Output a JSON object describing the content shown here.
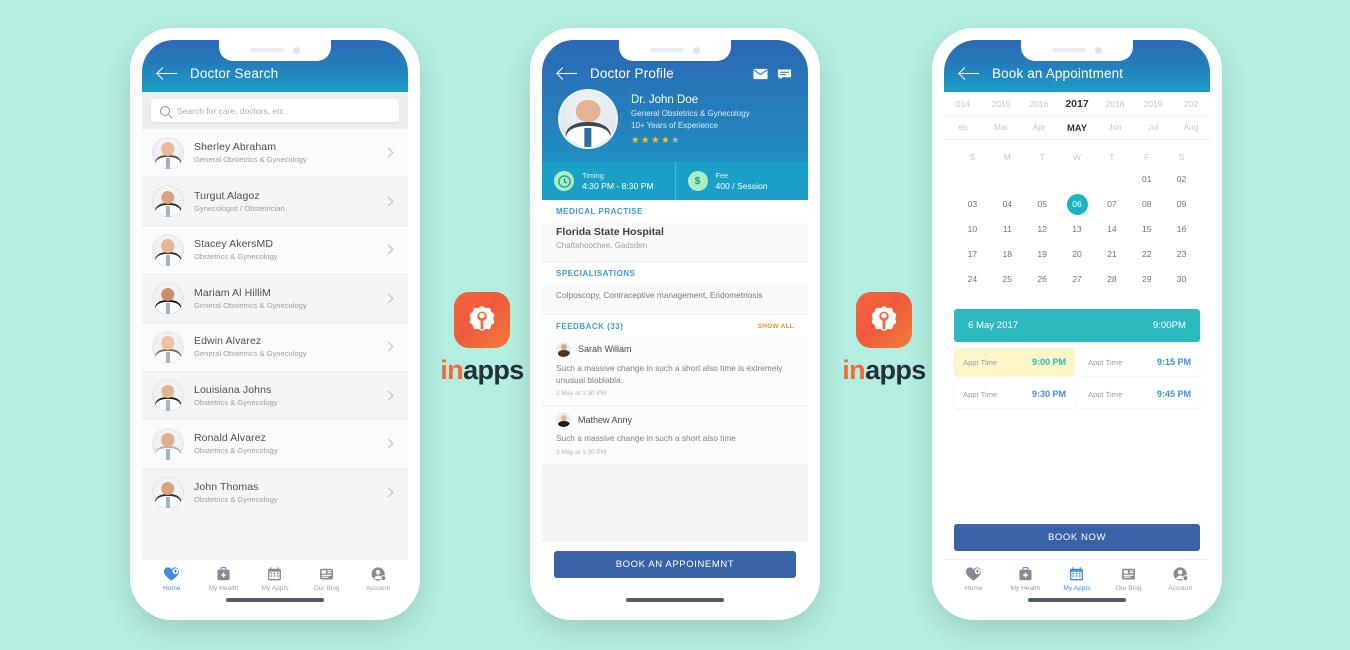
{
  "background_color": "#b3eee1",
  "brand": {
    "logo_name": "inapps",
    "logo_part_1": "in",
    "logo_part_2": "apps",
    "accent_orange": "#f26a3c",
    "text_dark": "#24303a"
  },
  "phone_1": {
    "header": {
      "title": "Doctor Search",
      "back_icon": "back-arrow-icon"
    },
    "search": {
      "placeholder": "Search for care, doctors, etc.",
      "value": "",
      "icon": "search-icon"
    },
    "doctors": [
      {
        "name": "Sherley Abraham",
        "specialty": "General Obstetrics & Gynecology"
      },
      {
        "name": "Turgut Alagoz",
        "specialty": "Gynecologist / Obstetrician"
      },
      {
        "name": "Stacey AkersMD",
        "specialty": "Obstetrics & Gynecology"
      },
      {
        "name": "Mariam Al HilliM",
        "specialty": "General Obstetrics & Gynecology"
      },
      {
        "name": "Edwin Alvarez",
        "specialty": "General Obstetrics & Gynecology"
      },
      {
        "name": "Louisiana Johns",
        "specialty": "Obstetrics & Gynecology"
      },
      {
        "name": "Ronald Alvarez",
        "specialty": "Obstetrics & Gynecology"
      },
      {
        "name": "John Thomas",
        "specialty": "Obstetrics & Gynecology"
      }
    ],
    "tabbar": {
      "active": "Home",
      "items": [
        {
          "label": "Home",
          "icon": "heart-plus-icon"
        },
        {
          "label": "My Health",
          "icon": "medical-kit-icon"
        },
        {
          "label": "My Appts",
          "icon": "calendar-icon"
        },
        {
          "label": "Our Blog",
          "icon": "article-icon"
        },
        {
          "label": "Account",
          "icon": "user-account-icon"
        }
      ]
    }
  },
  "phone_2": {
    "header": {
      "title": "Doctor Profile",
      "back_icon": "back-arrow-icon",
      "mail_icon": "envelope-icon",
      "chat_icon": "chat-bubble-icon"
    },
    "doctor": {
      "name": "Dr. John Doe",
      "specialty": "General Obstetrics & Gynecology",
      "experience": "10+ Years of Experience",
      "rating": 4,
      "rating_max": 5
    },
    "stats": [
      {
        "icon": "clock-icon",
        "label": "Timing",
        "value": "4:30 PM - 8:30 PM"
      },
      {
        "icon": "dollar-icon",
        "label": "Fee",
        "value": "400 / Session"
      }
    ],
    "medical_practise": {
      "heading": "MEDICAL PRACTISE",
      "hospital": "Florida State Hospital",
      "location": "Chattahoochee, Gadsden"
    },
    "specialisations": {
      "heading": "SPECIALISATIONS",
      "text": "Colposcopy, Contraceptive management, Endometriosis"
    },
    "feedback": {
      "heading": "FEEDBACK (33)",
      "show_all": "SHOW ALL",
      "items": [
        {
          "author": "Sarah Willam",
          "text": "Such a massive change in such a short also time is extremely unusual blablabla.",
          "time": "3 May at 1:30 PM"
        },
        {
          "author": "Mathew Anny",
          "text": "Such a massive change in such a short also time",
          "time": "3 May at 1:30 PM"
        }
      ]
    },
    "cta": "BOOK AN APPOINEMNT"
  },
  "phone_3": {
    "header": {
      "title": "Book an Appointment",
      "back_icon": "back-arrow-icon"
    },
    "years": [
      "014",
      "2015",
      "2016",
      "2017",
      "2018",
      "2019",
      "202"
    ],
    "selected_year": "2017",
    "months": [
      "eb",
      "Mar",
      "Apr",
      "MAY",
      "Jun",
      "Jul",
      "Aug"
    ],
    "selected_month": "MAY",
    "weekdays": [
      "S",
      "M",
      "T",
      "W",
      "T",
      "F",
      "S"
    ],
    "calendar_rows": [
      [
        "",
        "",
        "",
        "",
        "",
        "01",
        "02"
      ],
      [
        "03",
        "04",
        "05",
        "06",
        "07",
        "08",
        "09"
      ],
      [
        "10",
        "11",
        "12",
        "13",
        "14",
        "15",
        "16"
      ],
      [
        "17",
        "18",
        "19",
        "20",
        "21",
        "22",
        "23"
      ],
      [
        "24",
        "25",
        "26",
        "27",
        "28",
        "29",
        "30"
      ]
    ],
    "selected_day": "06",
    "selection_bar": {
      "date": "6 May 2017",
      "time": "9:00PM"
    },
    "slots": [
      {
        "label": "Appt Time",
        "time": "9:00 PM",
        "selected": true
      },
      {
        "label": "Appt Time",
        "time": "9:15 PM",
        "selected": false
      },
      {
        "label": "Appt Time",
        "time": "9:30 PM",
        "selected": false
      },
      {
        "label": "Appt Time",
        "time": "9:45 PM",
        "selected": false
      }
    ],
    "cta": "BOOK NOW",
    "tabbar": {
      "active": "My Appts",
      "items": [
        {
          "label": "Home",
          "icon": "heart-plus-icon"
        },
        {
          "label": "My Health",
          "icon": "medical-kit-icon"
        },
        {
          "label": "My Appts",
          "icon": "calendar-icon"
        },
        {
          "label": "Our Blog",
          "icon": "article-icon"
        },
        {
          "label": "Account",
          "icon": "user-account-icon"
        }
      ]
    }
  }
}
